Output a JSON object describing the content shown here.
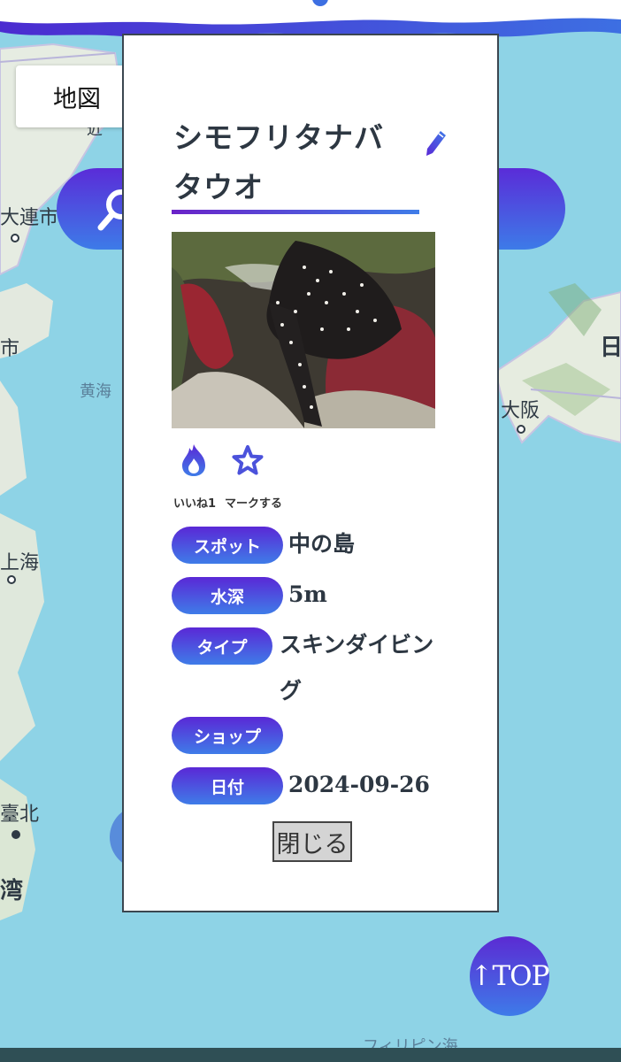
{
  "map": {
    "tab_label": "地図",
    "labels": {
      "dalian": "大連市",
      "yellow_sea": "黄海",
      "shanghai": "上海",
      "taipei": "臺北",
      "taiwan": "湾",
      "osaka": "大阪",
      "japan_partial": "日",
      "philippine_sea": "フィリピン海",
      "partial_top": "近",
      "partial_left": "市"
    }
  },
  "modal": {
    "title": "シモフリタナバタウオ",
    "like_label": "いいね1",
    "mark_label": "マークする",
    "fields": [
      {
        "label": "スポット",
        "value": "中の島"
      },
      {
        "label": "水深",
        "value": "5m"
      },
      {
        "label": "タイプ",
        "value": "スキンダイビング"
      },
      {
        "label": "ショップ",
        "value": ""
      },
      {
        "label": "日付",
        "value": "2024-09-26"
      }
    ],
    "close_label": "閉じる"
  },
  "top_button": {
    "label": "↑TOP"
  },
  "icons": {
    "search": "search-icon",
    "edit": "pencil-icon",
    "like": "flame-icon",
    "mark": "star-icon"
  },
  "colors": {
    "accent_start": "#5a28d6",
    "accent_end": "#3f7ce8",
    "sea": "#8ed3e6"
  }
}
